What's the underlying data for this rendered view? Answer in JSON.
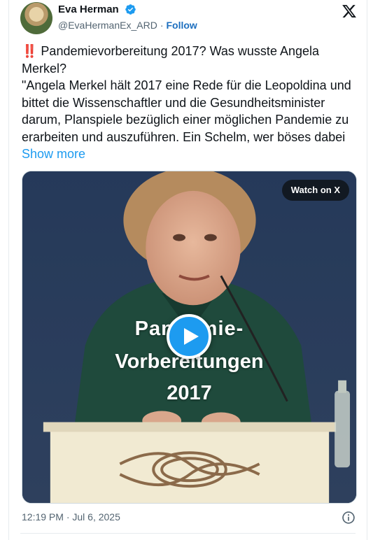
{
  "author": {
    "name": "Eva Herman",
    "handle": "@EvaHermanEx_ARD",
    "separator": "·",
    "follow_label": "Follow",
    "verified": true
  },
  "icons": {
    "verified": "verified-badge-icon",
    "brand": "x-logo-icon",
    "play": "play-icon",
    "info": "info-icon"
  },
  "tweet": {
    "emoji": "‼️",
    "line1": "Pandemievorbereitung 2017? Was wusste Angela Merkel?",
    "line2": "\"Angela Merkel hält 2017 eine Rede für die Leopoldina und bittet die Wissenschaftler und die Gesundheitsminister darum, Planspiele bezüglich einer möglichen Pandemie zu erarbeiten und auszuführen. Ein Schelm, wer böses dabei",
    "show_more": "Show more"
  },
  "media": {
    "watch_label": "Watch on X",
    "caption_line1": "Pandemie-",
    "caption_line2": "Vorbereitungen",
    "caption_line3": "2017"
  },
  "footer": {
    "timestamp": "12:19 PM · Jul 6, 2025"
  },
  "colors": {
    "accent": "#1d9bf0",
    "follow": "#1d6fbf",
    "text": "#0f1419",
    "muted": "#536471"
  }
}
